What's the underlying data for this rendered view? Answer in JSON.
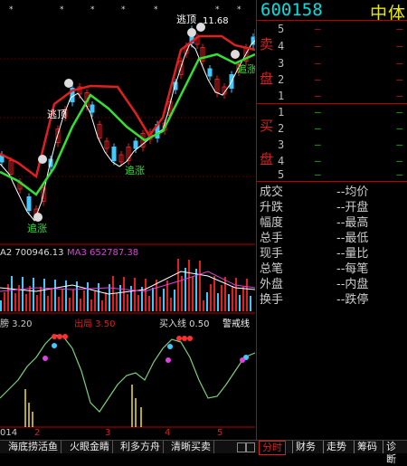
{
  "stock": {
    "code": "600158",
    "name": "中体"
  },
  "orderbook": {
    "sell_label": [
      "卖",
      "盘"
    ],
    "buy_label": [
      "买",
      "盘"
    ],
    "sell_levels": [
      "5",
      "4",
      "3",
      "2",
      "1"
    ],
    "buy_levels": [
      "1",
      "2",
      "3",
      "4",
      "5"
    ],
    "empty_value": "—"
  },
  "stats": {
    "left": [
      {
        "label": "成交",
        "value": "--均价"
      },
      {
        "label": "升跌",
        "value": "--开盘"
      },
      {
        "label": "幅度",
        "value": "--最高"
      },
      {
        "label": "总手",
        "value": "--最低"
      },
      {
        "label": "现手",
        "value": "--量比"
      },
      {
        "label": "总笔",
        "value": "--每笔"
      },
      {
        "label": "外盘",
        "value": "--内盘"
      },
      {
        "label": "换手",
        "value": "--跌停"
      }
    ]
  },
  "chart": {
    "peak_label": "11.68",
    "signals": {
      "escape_top": "逃顶",
      "chase_up": "追涨"
    },
    "volume_legend": {
      "ma2": "A2 700946.13",
      "ma3": "MA3 652787.38"
    },
    "indicator_legend": {
      "a": "膀 3.20",
      "b": "出局 3.50",
      "c": "买入线 0.50",
      "d": "警戒线"
    },
    "axis_year_fragment": "014",
    "period_marks": [
      "2",
      "3",
      "4",
      "5"
    ]
  },
  "tabs": {
    "bottom": [
      "海底捞活鱼",
      "火眼金睛",
      "利多方舟",
      "清晰买卖"
    ],
    "right": [
      "分时",
      "财务",
      "走势",
      "筹码",
      "诊断"
    ],
    "active_right": "分时"
  },
  "colors": {
    "up": "#d82020",
    "down": "#22c822",
    "code": "#00e0e0",
    "name": "#e8e800",
    "ma_white": "#ffffff",
    "ma_green": "#33e033",
    "ma_red": "#e02020",
    "candle_up": "#e02020",
    "candle_down": "#40c8ff"
  }
}
